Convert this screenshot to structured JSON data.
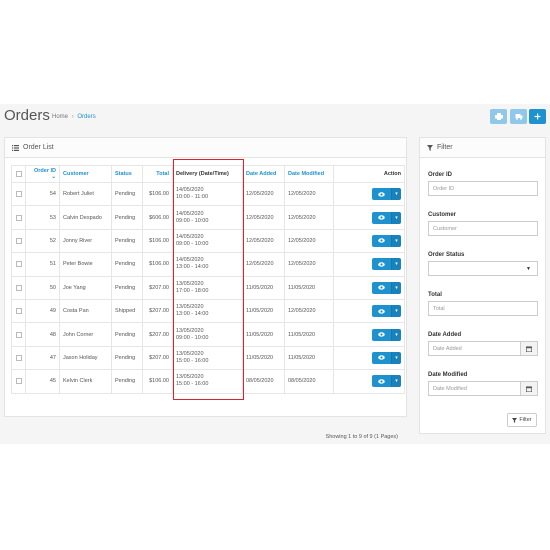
{
  "header": {
    "title": "Orders",
    "breadcrumb": {
      "home": "Home",
      "separator": "›",
      "current": "Orders"
    }
  },
  "order_list": {
    "panel_title": "Order List",
    "columns": {
      "order_id": "Order ID",
      "customer": "Customer",
      "status": "Status",
      "total": "Total",
      "delivery": "Delivery (Date/Time)",
      "date_added": "Date Added",
      "date_modified": "Date Modified",
      "action": "Action"
    },
    "rows": [
      {
        "id": "54",
        "customer": "Robert Juliet",
        "status": "Pending",
        "total": "$106.00",
        "delivery_date": "14/05/2020",
        "delivery_time": "10:00 - 11:00",
        "date_added": "12/05/2020",
        "date_modified": "12/05/2020"
      },
      {
        "id": "53",
        "customer": "Calvin Despado",
        "status": "Pending",
        "total": "$606.00",
        "delivery_date": "14/05/2020",
        "delivery_time": "09:00 - 10:00",
        "date_added": "12/05/2020",
        "date_modified": "12/05/2020"
      },
      {
        "id": "52",
        "customer": "Jonny River",
        "status": "Pending",
        "total": "$106.00",
        "delivery_date": "14/05/2020",
        "delivery_time": "09:00 - 10:00",
        "date_added": "12/05/2020",
        "date_modified": "12/05/2020"
      },
      {
        "id": "51",
        "customer": "Peter Bowie",
        "status": "Pending",
        "total": "$106.00",
        "delivery_date": "14/05/2020",
        "delivery_time": "13:00 - 14:00",
        "date_added": "12/05/2020",
        "date_modified": "12/05/2020"
      },
      {
        "id": "50",
        "customer": "Joe Yang",
        "status": "Pending",
        "total": "$207.00",
        "delivery_date": "13/05/2020",
        "delivery_time": "17:00 - 18:00",
        "date_added": "11/05/2020",
        "date_modified": "11/05/2020"
      },
      {
        "id": "49",
        "customer": "Costa Pan",
        "status": "Shipped",
        "total": "$207.00",
        "delivery_date": "13/05/2020",
        "delivery_time": "13:00 - 14:00",
        "date_added": "11/05/2020",
        "date_modified": "12/05/2020"
      },
      {
        "id": "48",
        "customer": "John Corner",
        "status": "Pending",
        "total": "$207.00",
        "delivery_date": "13/05/2020",
        "delivery_time": "09:00 - 10:00",
        "date_added": "11/05/2020",
        "date_modified": "11/05/2020"
      },
      {
        "id": "47",
        "customer": "Jason Holiday",
        "status": "Pending",
        "total": "$207.00",
        "delivery_date": "13/05/2020",
        "delivery_time": "15:00 - 16:00",
        "date_added": "11/05/2020",
        "date_modified": "11/05/2020"
      },
      {
        "id": "45",
        "customer": "Kelvin Clerk",
        "status": "Pending",
        "total": "$106.00",
        "delivery_date": "13/05/2020",
        "delivery_time": "15:00 - 16:00",
        "date_added": "08/05/2020",
        "date_modified": "08/05/2020"
      }
    ],
    "pagination": "Showing 1 to 9 of 9 (1 Pages)"
  },
  "filter": {
    "panel_title": "Filter",
    "order_id": {
      "label": "Order ID",
      "placeholder": "Order ID"
    },
    "customer": {
      "label": "Customer",
      "placeholder": "Customer"
    },
    "order_status": {
      "label": "Order Status",
      "value": ""
    },
    "total": {
      "label": "Total",
      "placeholder": "Total"
    },
    "date_added": {
      "label": "Date Added",
      "placeholder": "Date Added"
    },
    "date_modified": {
      "label": "Date Modified",
      "placeholder": "Date Modified"
    },
    "button": "Filter"
  },
  "colors": {
    "primary": "#1e91cf",
    "primary_light": "#8fc8e8",
    "highlight": "#d9242b"
  }
}
